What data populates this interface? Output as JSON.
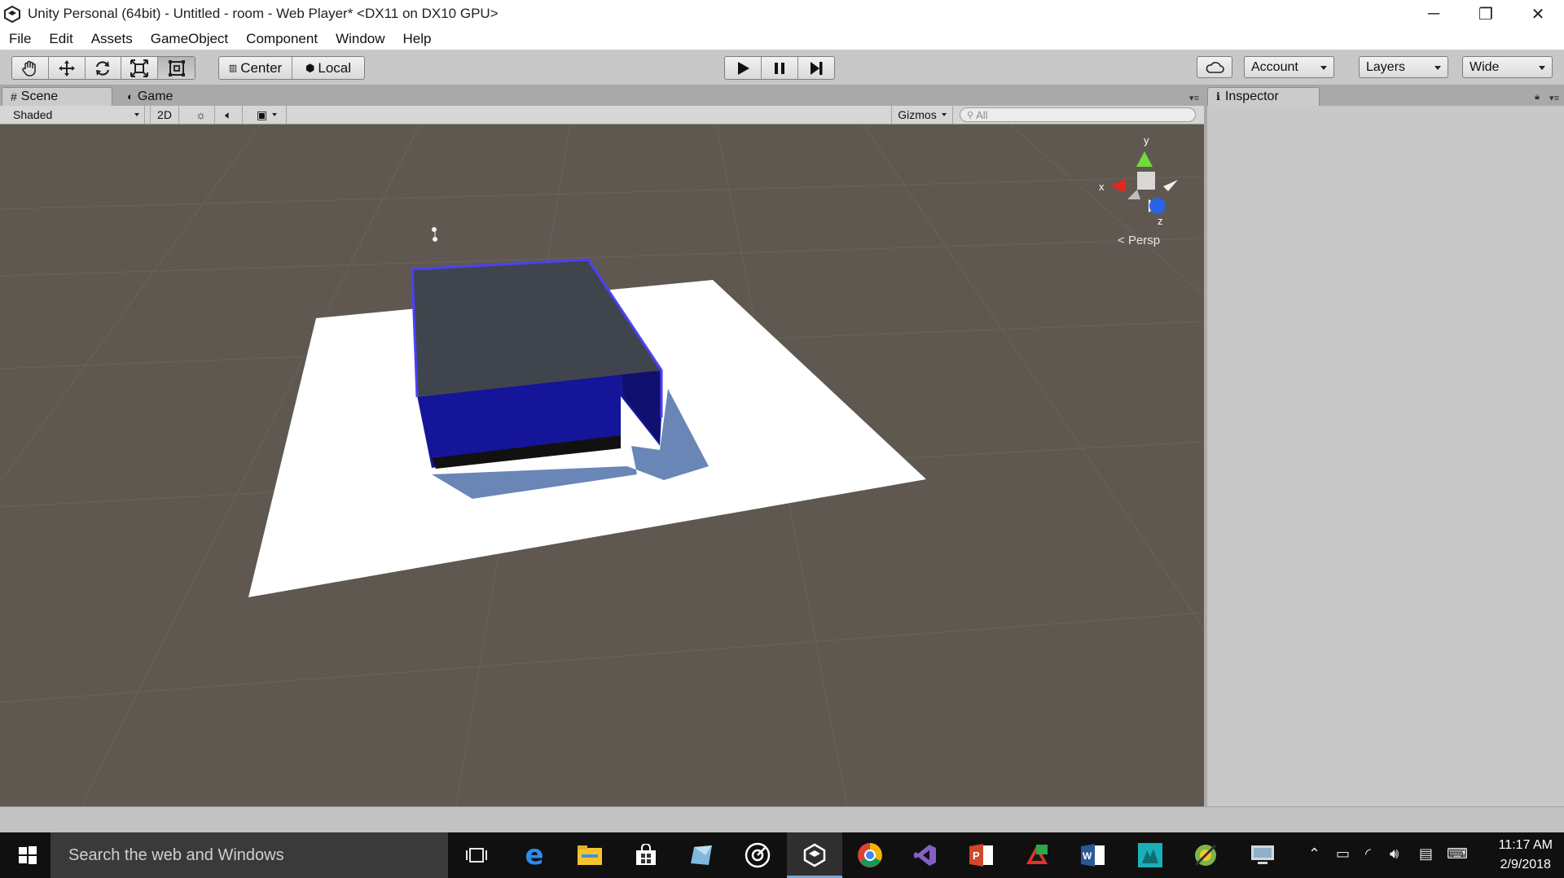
{
  "window": {
    "title": "Unity Personal (64bit) - Untitled - room - Web Player* <DX11 on DX10 GPU>",
    "controls": {
      "minimize": "─",
      "restore": "❐",
      "close": "✕"
    }
  },
  "menu": [
    "File",
    "Edit",
    "Assets",
    "GameObject",
    "Component",
    "Window",
    "Help"
  ],
  "toolbar": {
    "tools": [
      "hand-icon",
      "move-icon",
      "rotate-icon",
      "scale-icon",
      "rect-icon"
    ],
    "active_tool": "rect-icon",
    "pivot": "Center",
    "space": "Local",
    "play": [
      "play-icon",
      "pause-icon",
      "step-icon"
    ],
    "account": "Account",
    "layers": "Layers",
    "layout": "Wide"
  },
  "scene_panel": {
    "tabs": [
      {
        "label": "Scene",
        "active": true
      },
      {
        "label": "Game",
        "active": false
      }
    ],
    "shading": "Shaded",
    "mode_2d": "2D",
    "gizmos": "Gizmos",
    "search_placeholder": "All",
    "gizmo_axes": {
      "y": "y",
      "x": "x",
      "z": "z"
    },
    "projection": "Persp"
  },
  "inspector": {
    "tab": "Inspector"
  },
  "taskbar": {
    "search_placeholder": "Search the web and Windows",
    "time": "11:17 AM",
    "date": "2/9/2018"
  },
  "colors": {
    "viewport_bg": "#5f5850",
    "room_blue": "#1414a0",
    "floor": "#ffffff",
    "shadow": "#6a86b6"
  }
}
